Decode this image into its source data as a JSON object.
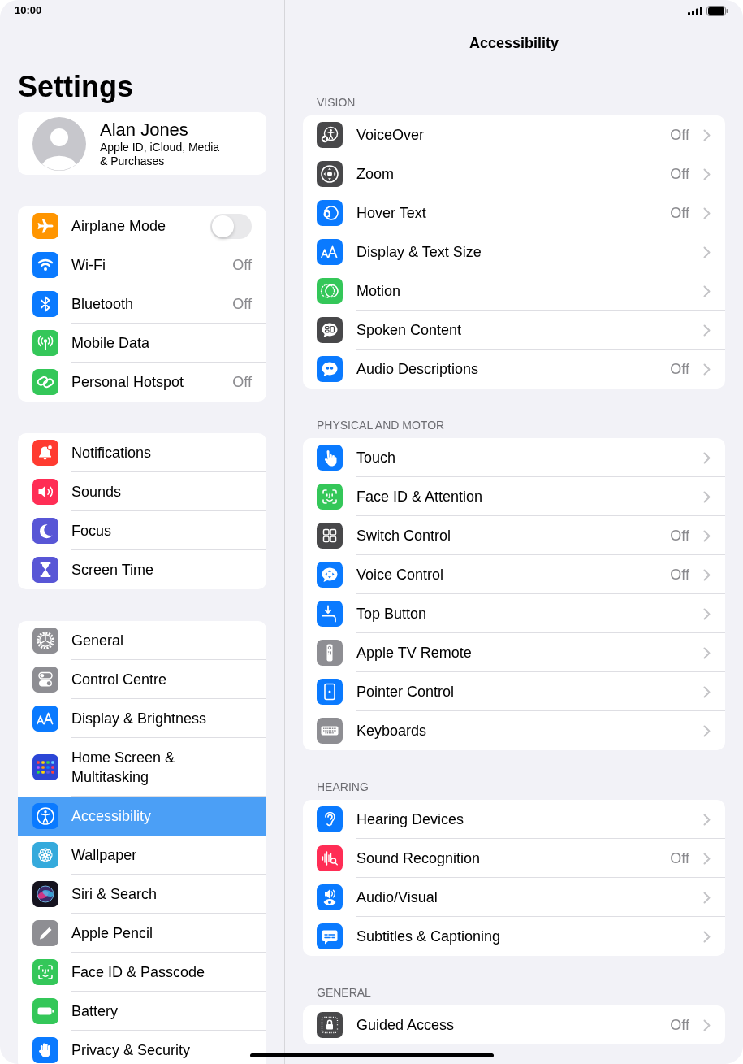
{
  "status_bar": {
    "time": "10:00"
  },
  "sidebar": {
    "title": "Settings",
    "profile": {
      "name": "Alan Jones",
      "subtitle": "Apple ID, iCloud, Media & Purchases"
    },
    "groups": [
      {
        "items": [
          {
            "label": "Airplane Mode",
            "kind": "toggle",
            "on": false,
            "selected": false
          },
          {
            "label": "Wi-Fi",
            "kind": "link",
            "value": "Off",
            "selected": false
          },
          {
            "label": "Bluetooth",
            "kind": "link",
            "value": "Off",
            "selected": false
          },
          {
            "label": "Mobile Data",
            "kind": "link",
            "selected": false
          },
          {
            "label": "Personal Hotspot",
            "kind": "link",
            "value": "Off",
            "selected": false
          }
        ]
      },
      {
        "items": [
          {
            "label": "Notifications",
            "selected": false
          },
          {
            "label": "Sounds",
            "selected": false
          },
          {
            "label": "Focus",
            "selected": false
          },
          {
            "label": "Screen Time",
            "selected": false
          }
        ]
      },
      {
        "items": [
          {
            "label": "General",
            "selected": false
          },
          {
            "label": "Control Centre",
            "selected": false
          },
          {
            "label": "Display & Brightness",
            "selected": false
          },
          {
            "label": "Home Screen & Multitasking",
            "selected": false
          },
          {
            "label": "Accessibility",
            "selected": true
          },
          {
            "label": "Wallpaper",
            "selected": false
          },
          {
            "label": "Siri & Search",
            "selected": false
          },
          {
            "label": "Apple Pencil",
            "selected": false
          },
          {
            "label": "Face ID & Passcode",
            "selected": false
          },
          {
            "label": "Battery",
            "selected": false
          },
          {
            "label": "Privacy & Security",
            "selected": false
          }
        ]
      }
    ]
  },
  "detail": {
    "title": "Accessibility",
    "sections": [
      {
        "header": "VISION",
        "items": [
          {
            "label": "VoiceOver",
            "value": "Off"
          },
          {
            "label": "Zoom",
            "value": "Off"
          },
          {
            "label": "Hover Text",
            "value": "Off"
          },
          {
            "label": "Display & Text Size"
          },
          {
            "label": "Motion"
          },
          {
            "label": "Spoken Content"
          },
          {
            "label": "Audio Descriptions",
            "value": "Off"
          }
        ]
      },
      {
        "header": "PHYSICAL AND MOTOR",
        "items": [
          {
            "label": "Touch"
          },
          {
            "label": "Face ID & Attention"
          },
          {
            "label": "Switch Control",
            "value": "Off"
          },
          {
            "label": "Voice Control",
            "value": "Off"
          },
          {
            "label": "Top Button"
          },
          {
            "label": "Apple TV Remote"
          },
          {
            "label": "Pointer Control"
          },
          {
            "label": "Keyboards"
          }
        ]
      },
      {
        "header": "HEARING",
        "items": [
          {
            "label": "Hearing Devices"
          },
          {
            "label": "Sound Recognition",
            "value": "Off"
          },
          {
            "label": "Audio/Visual"
          },
          {
            "label": "Subtitles & Captioning"
          }
        ]
      },
      {
        "header": "GENERAL",
        "items": [
          {
            "label": "Guided Access",
            "value": "Off"
          }
        ]
      }
    ]
  }
}
